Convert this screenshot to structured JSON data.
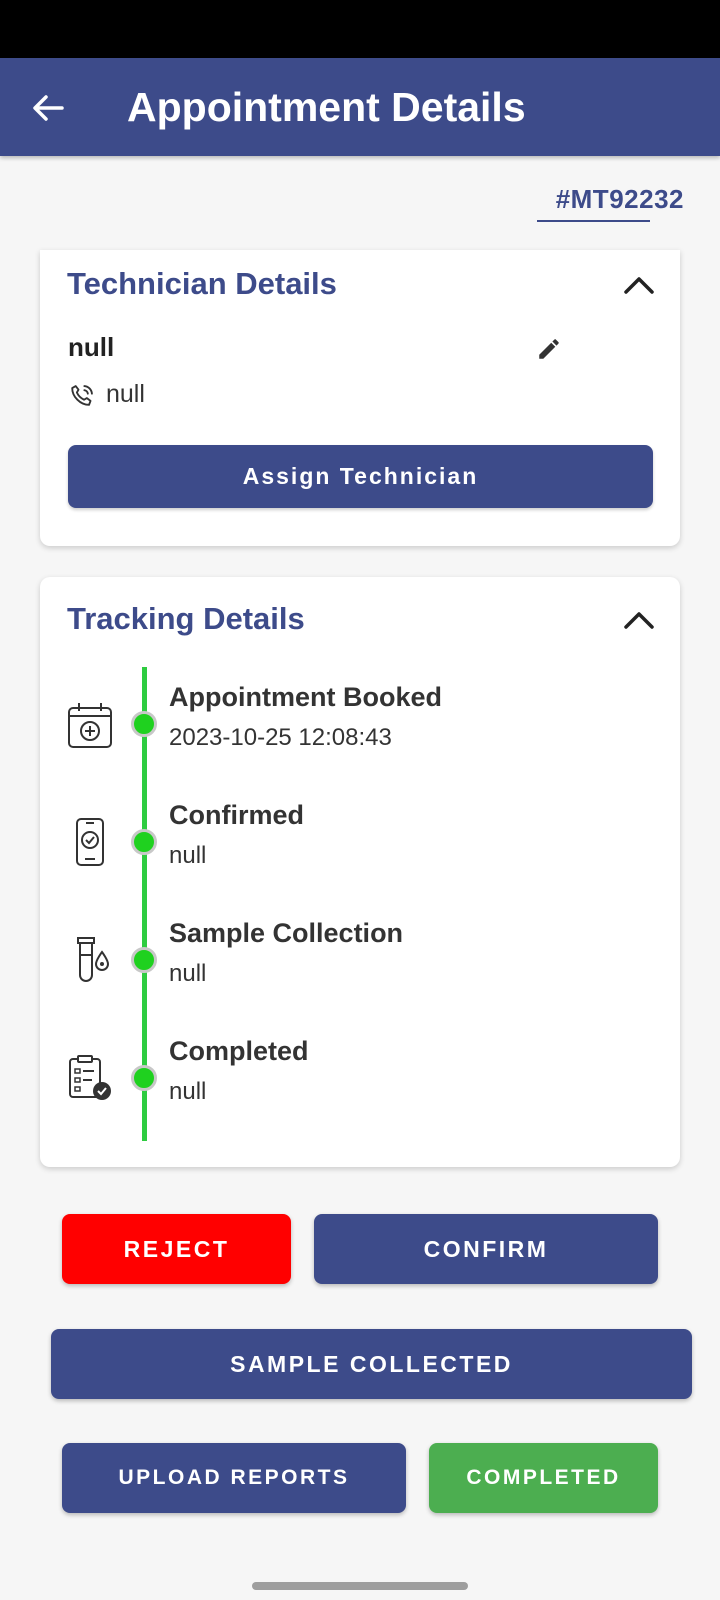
{
  "app_bar": {
    "title": "Appointment Details",
    "back_icon": "arrow-left-icon"
  },
  "order": {
    "id": "#MT92232"
  },
  "technician": {
    "title": "Technician Details",
    "name": "null",
    "phone": "null",
    "assign_label": "Assign Technician"
  },
  "tracking": {
    "title": "Tracking Details",
    "steps": [
      {
        "title": "Appointment Booked",
        "sub": "2023-10-25 12:08:43",
        "icon": "calendar-medical-icon"
      },
      {
        "title": "Confirmed",
        "sub": "null",
        "icon": "phone-check-icon"
      },
      {
        "title": "Sample Collection",
        "sub": "null",
        "icon": "test-tube-icon"
      },
      {
        "title": "Completed",
        "sub": "null",
        "icon": "clipboard-check-icon"
      }
    ]
  },
  "actions": {
    "reject": "REJECT",
    "confirm": "CONFIRM",
    "sample_collected": "SAMPLE COLLECTED",
    "upload_reports": "UPLOAD REPORTS",
    "completed": "COMPLETED"
  },
  "colors": {
    "primary": "#3d4b8a",
    "reject": "#ff0000",
    "completed": "#4cae50",
    "timeline": "#2ecc40"
  }
}
